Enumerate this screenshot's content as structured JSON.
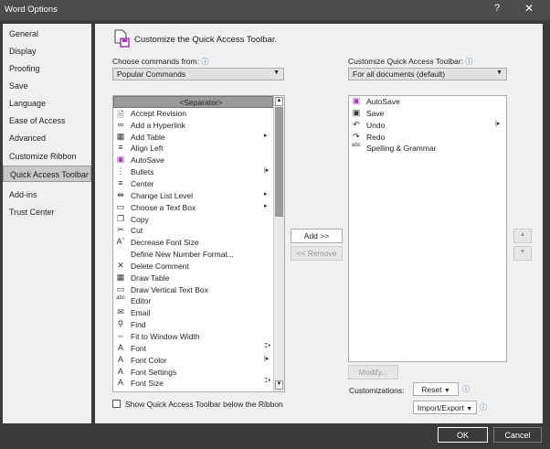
{
  "window": {
    "title": "Word Options",
    "help": "?",
    "close": "✕"
  },
  "sidebar": {
    "items": [
      {
        "label": "General"
      },
      {
        "label": "Display"
      },
      {
        "label": "Proofing"
      },
      {
        "label": "Save"
      },
      {
        "label": "Language"
      },
      {
        "label": "Ease of Access"
      },
      {
        "label": "Advanced"
      },
      {
        "label": "Customize Ribbon"
      },
      {
        "label": "Quick Access Toolbar",
        "selected": true
      },
      {
        "label": "Add-ins"
      },
      {
        "label": "Trust Center"
      }
    ]
  },
  "main": {
    "heading": "Customize the Quick Access Toolbar.",
    "choose_label": "Choose commands from:",
    "choose_value": "Popular Commands",
    "customize_label": "Customize Quick Access Toolbar:",
    "customize_value": "For all documents (default)",
    "commands": [
      {
        "label": "<Separator>",
        "icon": "none"
      },
      {
        "label": "Accept Revision",
        "icon": "accept-revision"
      },
      {
        "label": "Add a Hyperlink",
        "icon": "link"
      },
      {
        "label": "Add Table",
        "icon": "table",
        "submenu": true
      },
      {
        "label": "Align Left",
        "icon": "align-left"
      },
      {
        "label": "AutoSave",
        "icon": "save"
      },
      {
        "label": "Bullets",
        "icon": "bullets",
        "splitmenu": true
      },
      {
        "label": "Center",
        "icon": "align-center"
      },
      {
        "label": "Change List Level",
        "icon": "list-level",
        "submenu": true
      },
      {
        "label": "Choose a Text Box",
        "icon": "text-box",
        "submenu": true
      },
      {
        "label": "Copy",
        "icon": "copy"
      },
      {
        "label": "Cut",
        "icon": "scissors"
      },
      {
        "label": "Decrease Font Size",
        "icon": "font-decrease"
      },
      {
        "label": "Define New Number Format...",
        "icon": "none"
      },
      {
        "label": "Delete Comment",
        "icon": "delete-comment"
      },
      {
        "label": "Draw Table",
        "icon": "draw-table"
      },
      {
        "label": "Draw Vertical Text Box",
        "icon": "vertical-text-box"
      },
      {
        "label": "Editor",
        "icon": "spelling"
      },
      {
        "label": "Email",
        "icon": "email"
      },
      {
        "label": "Find",
        "icon": "search"
      },
      {
        "label": "Fit to Window Width",
        "icon": "fit-width"
      },
      {
        "label": "Font",
        "icon": "font",
        "combo": true
      },
      {
        "label": "Font Color",
        "icon": "font-color",
        "splitmenu": true
      },
      {
        "label": "Font Settings",
        "icon": "font-settings"
      },
      {
        "label": "Font Size",
        "icon": "font-size",
        "combo": true
      }
    ],
    "toolbar_items": [
      {
        "label": "AutoSave",
        "icon": "save"
      },
      {
        "label": "Save",
        "icon": "save-disk"
      },
      {
        "label": "Undo",
        "icon": "undo",
        "splitmenu": true
      },
      {
        "label": "Redo",
        "icon": "redo"
      },
      {
        "label": "Spelling & Grammar",
        "icon": "spelling"
      }
    ],
    "add": "Add >>",
    "remove": "<< Remove",
    "modify": "Modify...",
    "show_below": "Show Quick Access Toolbar below the Ribbon",
    "customizations_label": "Customizations:",
    "reset": "Reset",
    "import_export": "Import/Export"
  },
  "footer": {
    "ok": "OK",
    "cancel": "Cancel"
  }
}
